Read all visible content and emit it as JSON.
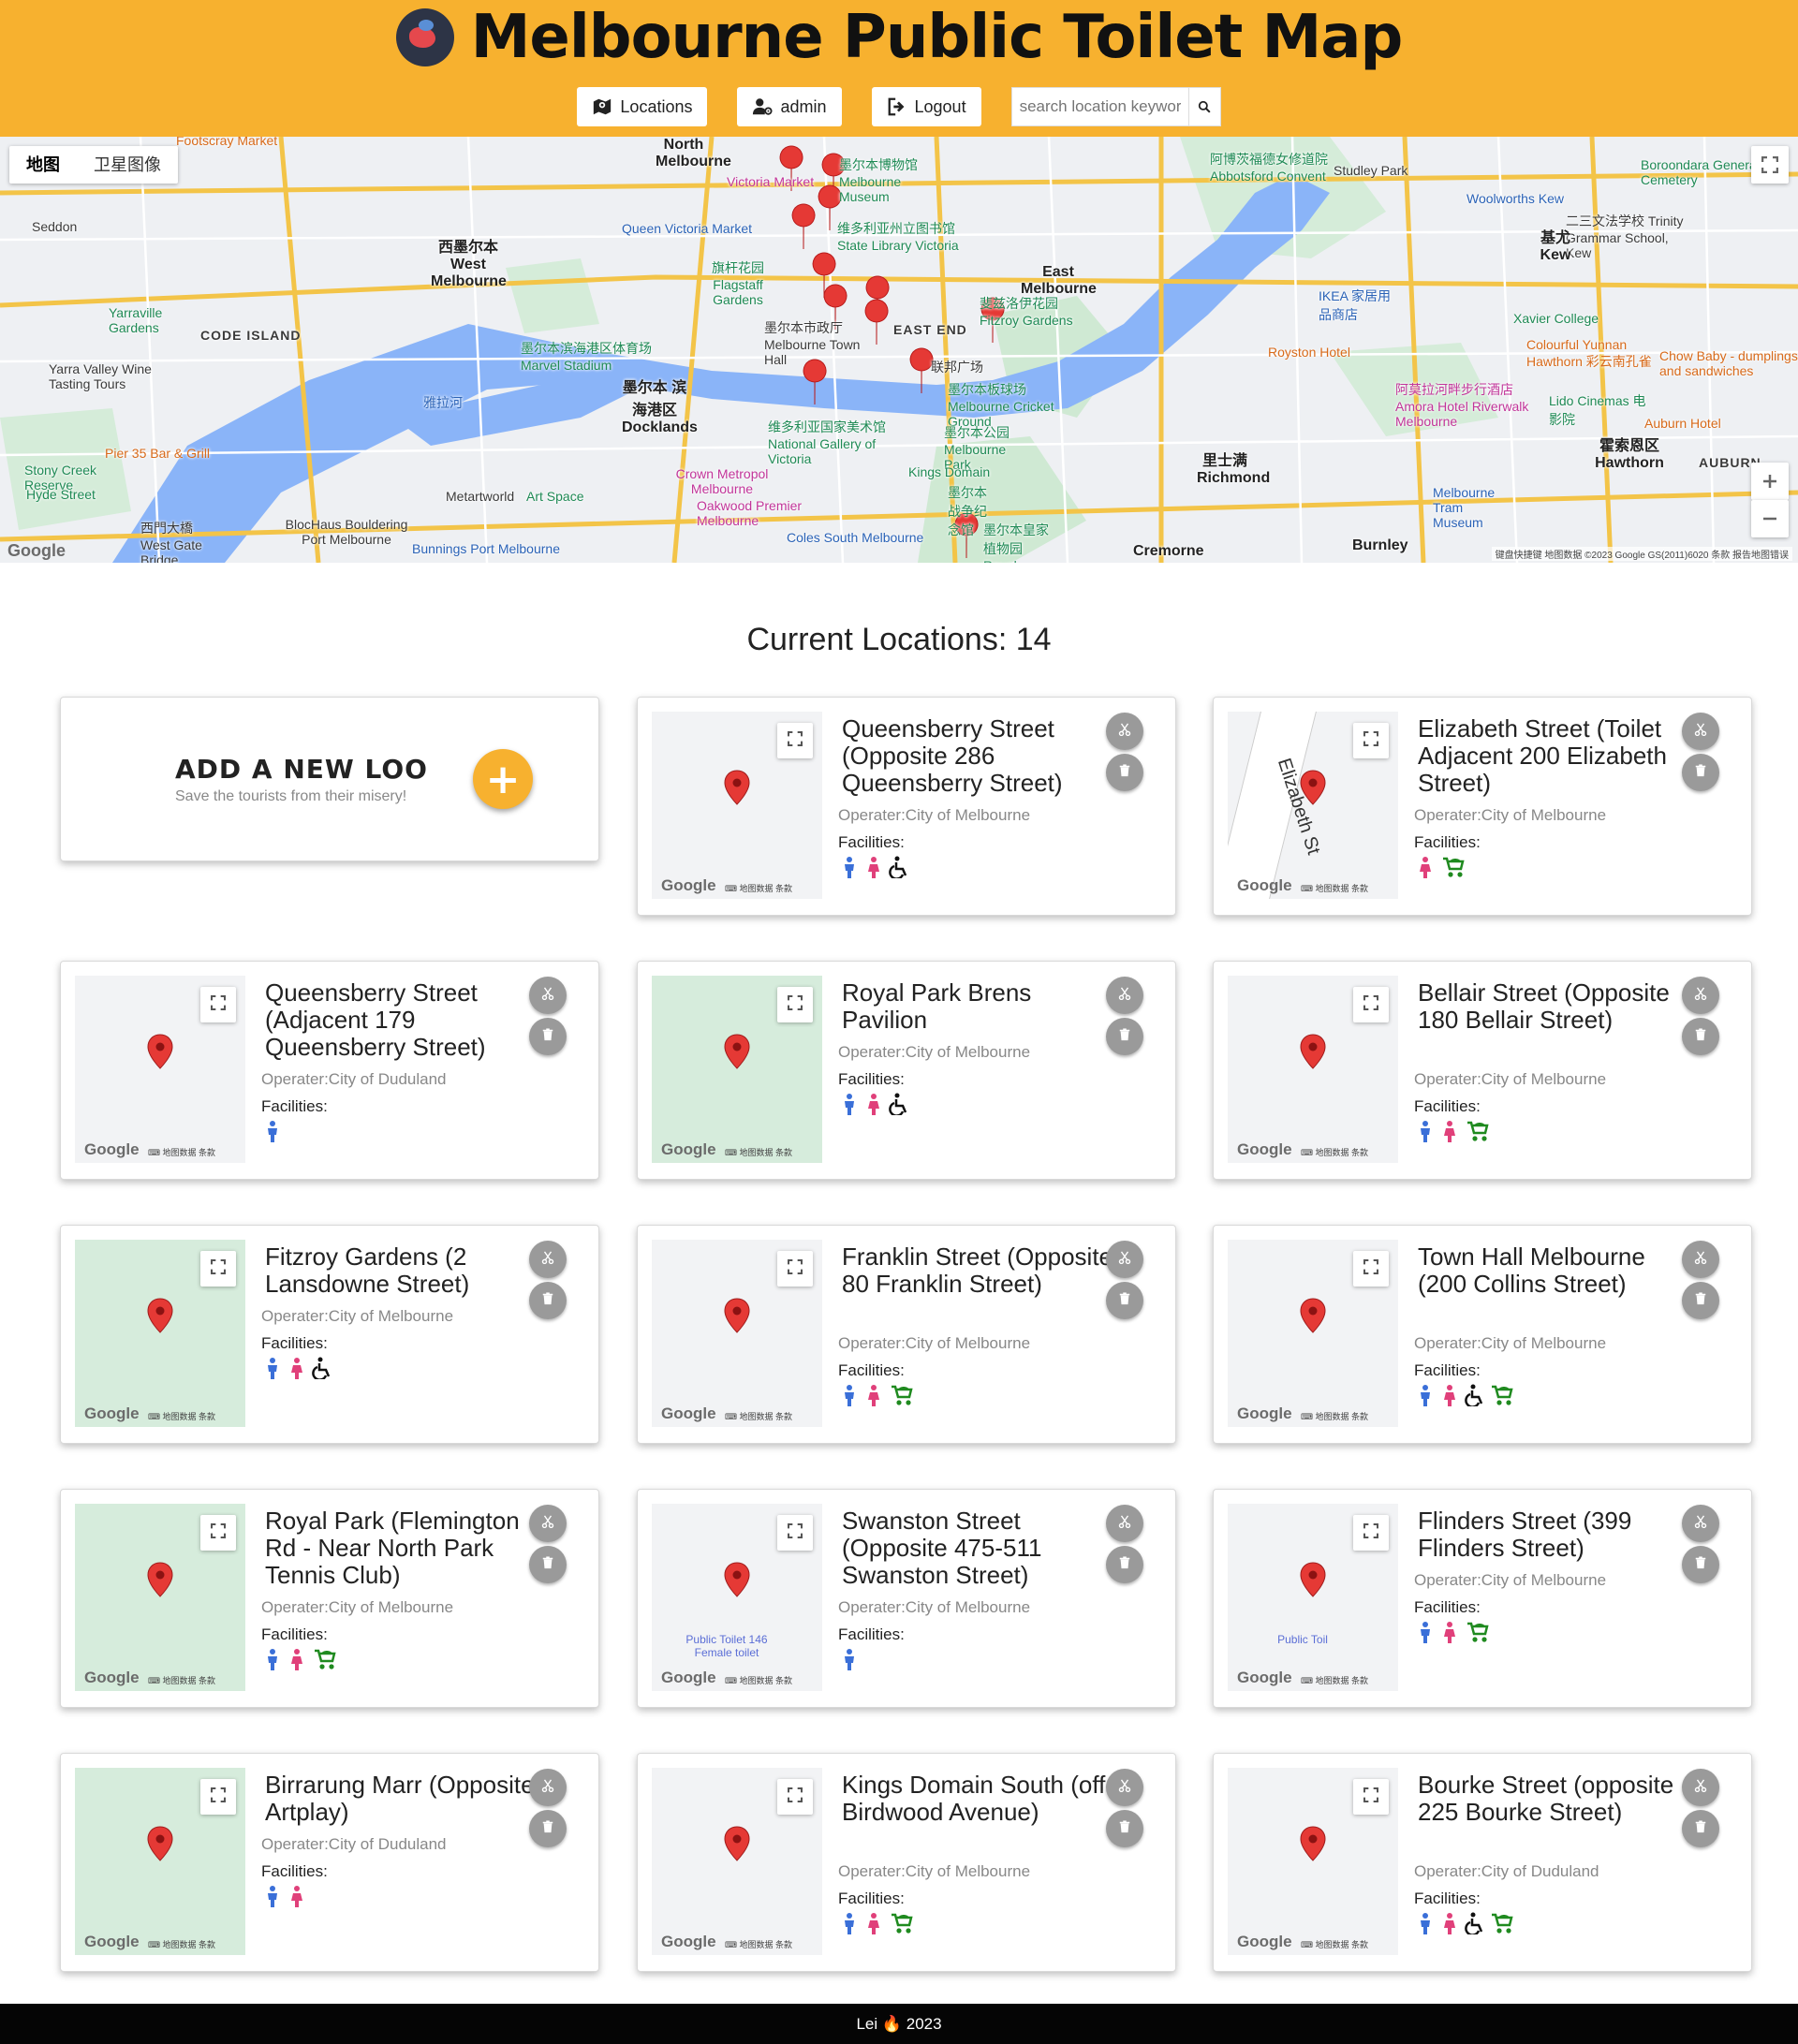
{
  "header": {
    "title": "Melbourne Public Toilet Map",
    "nav": {
      "locations": "Locations",
      "admin": "admin",
      "logout": "Logout"
    },
    "search_placeholder": "search location keyword"
  },
  "map": {
    "type_map": "地图",
    "type_satellite": "卫星图像",
    "footer": "键盘快捷键  地图数据 ©2023 Google GS(2011)6020  条款  报告地图错误",
    "labels": [
      "Footscray Market",
      "Seddon",
      "Yarraville Gardens",
      "Yarra Valley Wine Tasting Tours",
      "CODE ISLAND",
      "西墨尔本 West Melbourne",
      "North Melbourne",
      "Queen Victoria Market",
      "Victoria Market",
      "墨尔本博物馆 Melbourne Museum",
      "维多利亚州立图书馆 State Library Victoria",
      "旗杆花园 Flagstaff Gardens",
      "墨尔本滨海港区体育场 Marvel Stadium",
      "墨尔本 滨海港区 Docklands",
      "雅拉河",
      "墨尔本市政厅 Melbourne Town Hall",
      "EAST END",
      "East Melbourne",
      "斐兹洛伊花园 Fitzroy Gardens",
      "联邦广场",
      "墨尔本板球场 Melbourne Cricket Ground",
      "维多利亚国家美术馆 National Gallery of Victoria",
      "墨尔本公园 Melbourne Park",
      "Kings Domain",
      "墨尔本战争纪念馆",
      "墨尔本皇家植物园 Royal Botanic",
      "Crown Metropol Melbourne",
      "Oakwood Premier Melbourne",
      "Coles South Melbourne",
      "Pier 35 Bar & Grill",
      "Stony Creek Reserve",
      "Hyde Street",
      "BlocHaus Bouldering Port Melbourne",
      "Metartworld",
      "Art Space",
      "Bunnings Port Melbourne",
      "西門大橋 West Gate Bridge",
      "里士满 Richmond",
      "Cremorne",
      "Burnley",
      "阿博茨福德女修道院 Abbotsford Convent",
      "Studley Park",
      "Boroondara General Cemetery",
      "Woolworths Kew",
      "二三文法学校 Trinity Grammar School, Kew",
      "基尤 Kew",
      "IKEA 家居用品商店",
      "Royston Hotel",
      "Xavier College",
      "Colourful Yunnan Hawthorn 彩云南孔雀",
      "Chow Baby - dumplings and sandwiches",
      "阿莫拉河畔步行酒店 Amora Hotel Riverwalk Melbourne",
      "Lido Cinemas 电影院",
      "Auburn Hotel",
      "霍索恩区 Hawthorn",
      "AUBURN",
      "Melbourne Tram Museum"
    ]
  },
  "count_label": "Current Locations: 14",
  "add_card": {
    "title": "ADD A NEW LOO",
    "subtitle": "Save the tourists from their misery!",
    "plus": "+"
  },
  "thumb": {
    "google": "Google",
    "footer": "⌨  地图数据  条款"
  },
  "facilities_label": "Facilities:",
  "locations": [
    {
      "title": "Queensberry Street (Opposite 286 Queensberry Street)",
      "operator": "Operater:City of Melbourne",
      "facilities": [
        "male",
        "female",
        "accessible"
      ]
    },
    {
      "title": "Elizabeth Street (Toilet Adjacent 200 Elizabeth Street)",
      "operator": "Operater:City of Melbourne",
      "facilities": [
        "female",
        "baby"
      ],
      "street": "Elizabeth St"
    },
    {
      "title": "Queensberry Street (Adjacent 179 Queensberry Street)",
      "operator": "Operater:City of Duduland",
      "facilities": [
        "male"
      ]
    },
    {
      "title": "Royal Park Brens Pavilion",
      "operator": "Operater:City of Melbourne",
      "facilities": [
        "male",
        "female",
        "accessible"
      ]
    },
    {
      "title": "Bellair Street (Opposite 180 Bellair Street)",
      "operator": "Operater:City of Melbourne",
      "facilities": [
        "male",
        "female",
        "baby"
      ]
    },
    {
      "title": "Fitzroy Gardens (2 Lansdowne Street)",
      "operator": "Operater:City of Melbourne",
      "facilities": [
        "male",
        "female",
        "accessible"
      ]
    },
    {
      "title": "Franklin Street (Opposite 80 Franklin Street)",
      "operator": "Operater:City of Melbourne",
      "facilities": [
        "male",
        "female",
        "baby"
      ]
    },
    {
      "title": "Town Hall Melbourne (200 Collins Street)",
      "operator": "Operater:City of Melbourne",
      "facilities": [
        "male",
        "female",
        "accessible",
        "baby"
      ]
    },
    {
      "title": "Royal Park (Flemington Rd - Near North Park Tennis Club)",
      "operator": "Operater:City of Melbourne",
      "facilities": [
        "male",
        "female",
        "baby"
      ]
    },
    {
      "title": "Swanston Street (Opposite 475-511 Swanston Street)",
      "operator": "Operater:City of Melbourne",
      "facilities": [
        "male"
      ],
      "map_text": "Public Toilet 146 Female toilet"
    },
    {
      "title": "Flinders Street (399 Flinders Street)",
      "operator": "Operater:City of Melbourne",
      "facilities": [
        "male",
        "female",
        "baby"
      ],
      "map_text": "Public Toil"
    },
    {
      "title": "Birrarung Marr (Opposite Artplay)",
      "operator": "Operater:City of Duduland",
      "facilities": [
        "male",
        "female"
      ]
    },
    {
      "title": "Kings Domain South (off Birdwood Avenue)",
      "operator": "Operater:City of Melbourne",
      "facilities": [
        "male",
        "female",
        "baby"
      ]
    },
    {
      "title": "Bourke Street (opposite 225 Bourke Street)",
      "operator": "Operater:City of Duduland",
      "facilities": [
        "male",
        "female",
        "accessible",
        "baby"
      ]
    }
  ],
  "footer": {
    "text": "Lei 🔥 2023"
  },
  "colors": {
    "brand": "#f7b12f",
    "male": "#3a6fd8",
    "female": "#e0407a",
    "baby": "#1f8a1f",
    "pin": "#e53935"
  },
  "icons": {
    "map_pin": "map-pin-icon",
    "scissors": "scissors-icon",
    "trash": "trash-icon",
    "fullscreen": "fullscreen-icon"
  }
}
